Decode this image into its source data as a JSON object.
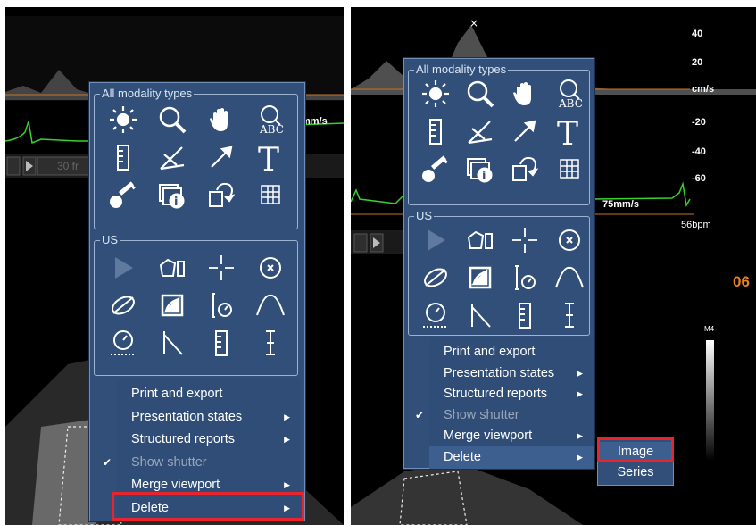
{
  "left_panel": {
    "group_all": "All modality types",
    "group_us": "US",
    "speed_label": "mm/s",
    "frames_label": "30 fr",
    "menu_items": [
      {
        "label": "Print and export",
        "has_submenu": false
      },
      {
        "label": "Presentation states",
        "has_submenu": true
      },
      {
        "label": "Structured reports",
        "has_submenu": true
      },
      {
        "label": "Show shutter",
        "has_submenu": false,
        "checked": true,
        "disabled": true
      },
      {
        "label": "Merge viewport",
        "has_submenu": true
      },
      {
        "label": "Delete",
        "has_submenu": true,
        "highlighted": true
      }
    ]
  },
  "right_panel": {
    "group_all": "All modality types",
    "group_us": "US",
    "scale": [
      "40",
      "20",
      "cm/s",
      "-20",
      "-40",
      "-60"
    ],
    "speed_label": "75mm/s",
    "bpm_label": "56bpm",
    "frame_number": "06",
    "colorbar_label": "M4",
    "menu_items": [
      {
        "label": "Print and export",
        "has_submenu": false
      },
      {
        "label": "Presentation states",
        "has_submenu": true
      },
      {
        "label": "Structured reports",
        "has_submenu": true
      },
      {
        "label": "Show shutter",
        "has_submenu": false,
        "checked": true,
        "disabled": true
      },
      {
        "label": "Merge viewport",
        "has_submenu": true
      },
      {
        "label": "Delete",
        "has_submenu": true,
        "selected": true
      }
    ],
    "delete_submenu": [
      "Image",
      "Series"
    ]
  },
  "icons": {
    "all_row1": [
      "brightness-icon",
      "zoom-icon",
      "pan-hand-icon",
      "annotation-abc-icon"
    ],
    "all_row2": [
      "ruler-icon",
      "angle-icon",
      "arrow-icon",
      "text-icon"
    ],
    "all_row3": [
      "key-icon",
      "info-layers-icon",
      "rotate-icon",
      "grid-icon"
    ],
    "us_row1": [
      "play-icon",
      "polygon-icon",
      "crosshair-icon",
      "ellipse-point-icon"
    ],
    "us_row2": [
      "ellipse-icon",
      "area-icon",
      "velocity-icon",
      "curve-icon"
    ],
    "us_row3": [
      "timer-icon",
      "slope-icon",
      "ruler-icon",
      "caliper-icon"
    ]
  },
  "colors": {
    "menu_bg": "#314f78",
    "highlight": "#e8242c",
    "ecg": "#39d12a",
    "orange": "#c8742a"
  }
}
